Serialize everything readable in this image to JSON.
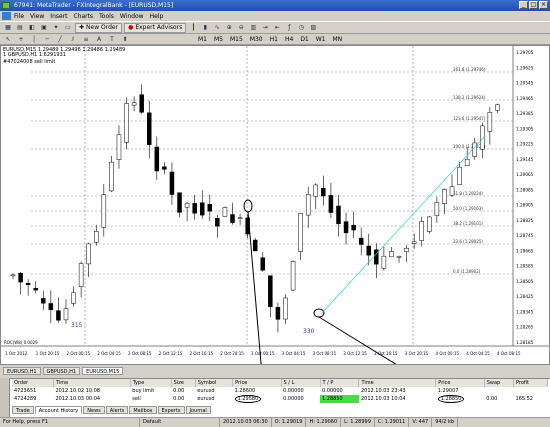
{
  "window": {
    "title": "67941: MetaTrader - FXIntegralBank - [EURUSD,M15]",
    "controls": [
      "_",
      "□",
      "×"
    ]
  },
  "menu": [
    "File",
    "View",
    "Insert",
    "Charts",
    "Tools",
    "Window",
    "Help"
  ],
  "toolbar": {
    "new_order": "New Order",
    "expert_advisors": "Expert Advisors",
    "timeframes": [
      "M1",
      "M5",
      "M15",
      "M30",
      "H1",
      "H4",
      "D1",
      "W1",
      "MN"
    ]
  },
  "chart": {
    "title": "EURUSD,M15  1.29489 1.29496 1.29486 1.29489",
    "subtitle": "1 GBPUSD,H1 1.6291931",
    "indicator_label": "#47024008 sell limit",
    "price_labels": [
      "1.29705",
      "1.29625",
      "1.29545",
      "1.29465",
      "1.29385",
      "1.29305",
      "1.29225",
      "1.29145",
      "1.29065",
      "1.28985",
      "1.28905",
      "1.28825",
      "1.28745",
      "1.28665",
      "1.28585",
      "1.28505",
      "1.28425",
      "1.28345",
      "1.28265",
      "1.28185"
    ],
    "time_labels": [
      "1 Oct 2012",
      "1 Oct 20:15",
      "2 Oct 00:15",
      "2 Oct 04:15",
      "2 Oct 08:15",
      "2 Oct 12:15",
      "2 Oct 16:15",
      "2 Oct 20:15",
      "3 Oct 00:15",
      "3 Oct 04:15",
      "3 Oct 08:15",
      "3 Oct 12:15",
      "3 Oct 16:15",
      "3 Oct 20:15",
      "4 Oct 00:15",
      "4 Oct 04:15",
      "4 Oct 08:15"
    ],
    "fib_labels": [
      "161.8 (1.29746)",
      "138.2 (1.29624)",
      "123.6 (1.29547)",
      "100.0 (1.29424)",
      "61.8 (1.29224)",
      "50.0 (1.29163)",
      "38.2 (1.29101)",
      "23.6 (1.29025)",
      "0.0 (1.28902)"
    ],
    "wave_labels": [
      "330",
      "315"
    ],
    "bottom_indicator": "ROC(W8) 0.0029"
  },
  "chart_tabs": [
    "EURUSD,H1",
    "GBPUSD,H1",
    "EURUSD,M15"
  ],
  "orders": {
    "columns": [
      "Order",
      "Time",
      "Type",
      "Size",
      "Symbol",
      "Price",
      "S / L",
      "T / P",
      "Time",
      "Price",
      "Swap",
      "Profit"
    ],
    "rows": [
      [
        "4723651",
        "2012.10.02 10:08",
        "buy limit",
        "0.00",
        "eurusd",
        "1.28600",
        "0.00000",
        "0.00000",
        "2012.10.03 23:43",
        "1.29007",
        "",
        ""
      ],
      [
        "4724289",
        "2012.10.03 00:04",
        "sell",
        "0.00",
        "eurusd",
        "1.29580",
        "0.00000",
        "1.28850",
        "2012.10.03 10:04",
        "1.28850",
        "0.00",
        "165.52"
      ]
    ]
  },
  "terminal_tabs": [
    "Trade",
    "Account History",
    "News",
    "Alerts",
    "Mailbox",
    "Experts",
    "Journal"
  ],
  "status": {
    "help": "For Help, press F1",
    "profile": "Default",
    "time": "2012.10.03 06:30",
    "open": "O: 1.29019",
    "high": "H: 1.29060",
    "low": "L: 1.28999",
    "close": "C: 1.29011",
    "volume": "V: 447",
    "traffic": "94/2 kb"
  },
  "colors": {
    "accent": "#1e4fae",
    "tp": "#4cd94c",
    "fib": "#888888",
    "up_candle": "#ffffff",
    "down_candle": "#000000"
  }
}
